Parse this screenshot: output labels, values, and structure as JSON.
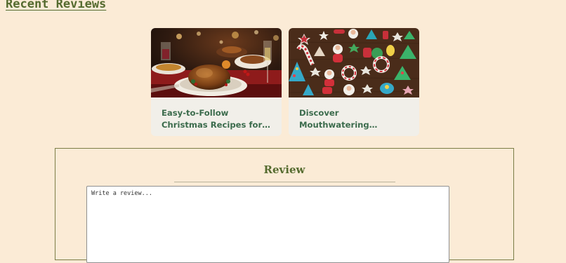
{
  "recent_reviews": {
    "title": "Recent Reviews",
    "cards": [
      {
        "title": "Easy-to-Follow Christmas Recipes for a...",
        "image": "christmas-dinner-photo"
      },
      {
        "title": "Discover Mouthwatering Christmas Treats on...",
        "image": "christmas-cookies-photo"
      }
    ]
  },
  "review_form": {
    "heading": "Review",
    "placeholder": "Write a review..."
  },
  "colors": {
    "page_background": "#fbebd6",
    "accent_olive": "#556b2f",
    "card_background": "#f1efe9",
    "card_title": "#3b6b4c"
  }
}
